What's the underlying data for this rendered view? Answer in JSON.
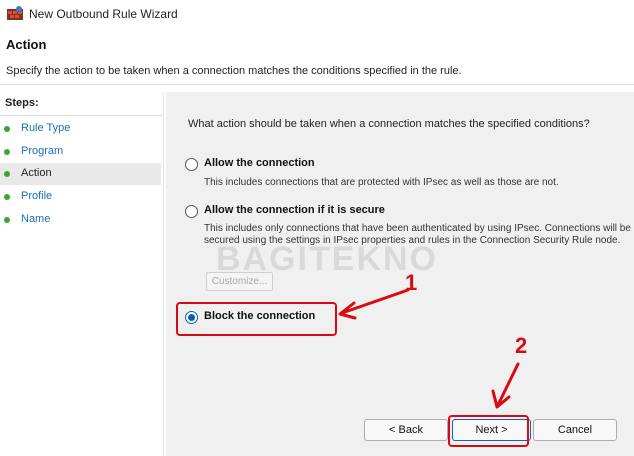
{
  "window": {
    "title": "New Outbound Rule Wizard",
    "icon": "firewall-wizard-icon"
  },
  "header": {
    "title": "Action",
    "description": "Specify the action to be taken when a connection matches the conditions specified in the rule."
  },
  "sidebar": {
    "steps_label": "Steps:",
    "items": [
      {
        "label": "Rule Type"
      },
      {
        "label": "Program"
      },
      {
        "label": "Action"
      },
      {
        "label": "Profile"
      },
      {
        "label": "Name"
      }
    ]
  },
  "main": {
    "question": "What action should be taken when a connection matches the specified conditions?",
    "options": [
      {
        "label": "Allow the connection",
        "description": "This includes connections that are protected with IPsec as well as those are not.",
        "selected": false
      },
      {
        "label": "Allow the connection if it is secure",
        "description": "This includes only connections that have been authenticated by using IPsec.  Connections will be secured using the settings in IPsec properties and rules in the Connection Security Rule node.",
        "selected": false
      },
      {
        "label": "Block the connection",
        "selected": true
      }
    ],
    "customize_label": "Customize..."
  },
  "buttons": {
    "back": "< Back",
    "next": "Next >",
    "cancel": "Cancel"
  },
  "annotations": {
    "marker1": "1",
    "marker2": "2",
    "color": "#d90b12"
  },
  "watermark": "BAGITEKNO"
}
